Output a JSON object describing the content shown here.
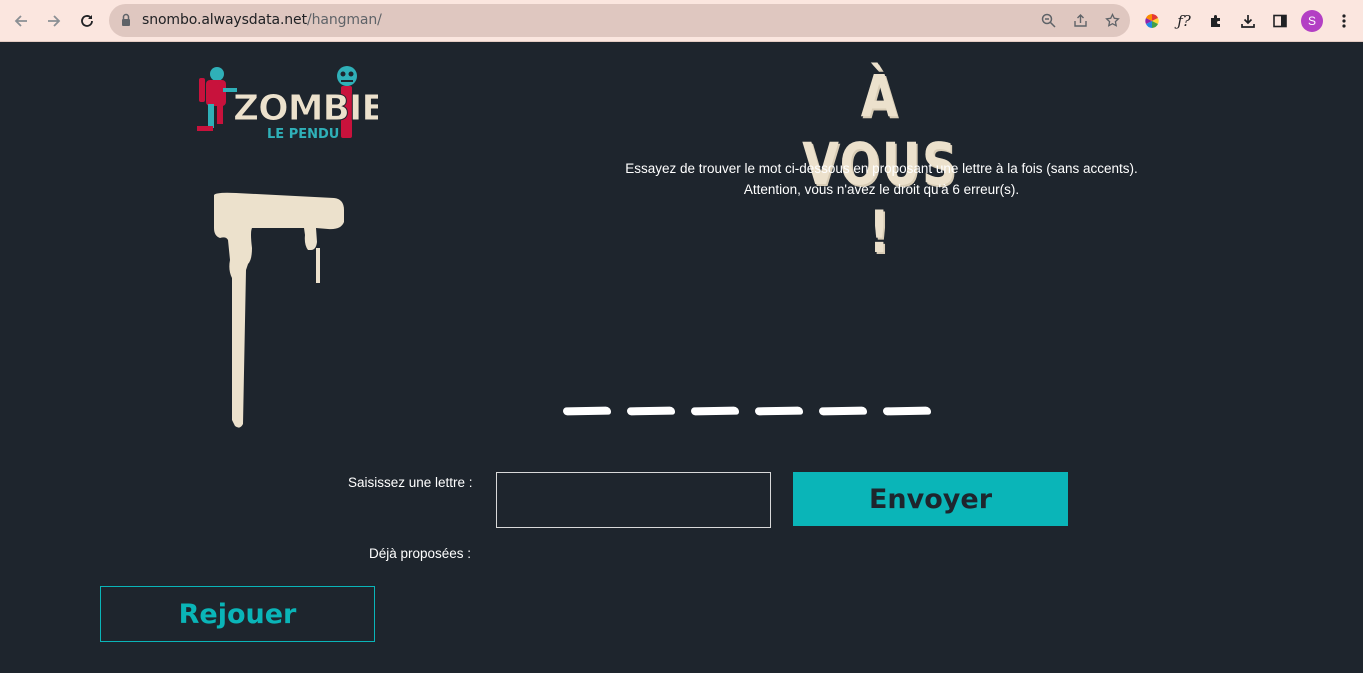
{
  "browser": {
    "url_host": "snombo.alwaysdata.net",
    "url_path": "/hangman/",
    "avatar_letter": "S"
  },
  "logo": {
    "word": "ZOMBIE",
    "subtitle": "LE PENDU"
  },
  "page": {
    "title": "À VOUS !",
    "instruction_line1": "Essayez de trouver le mot ci-dessous en proposant une lettre à la fois (sans accents).",
    "instruction_line2": "Attention, vous n'avez le droit qu'à 6 erreur(s).",
    "word_length": 6,
    "max_errors": 6
  },
  "form": {
    "letter_label": "Saisissez une lettre :",
    "letter_value": "",
    "send_label": "Envoyer",
    "guessed_label": "Déjà proposées :",
    "guessed_letters": ""
  },
  "replay": {
    "label": "Rejouer"
  },
  "colors": {
    "background": "#1e252d",
    "accent": "#0ab5b8",
    "bone": "#ece1cc",
    "zombie_red": "#c8123c"
  }
}
